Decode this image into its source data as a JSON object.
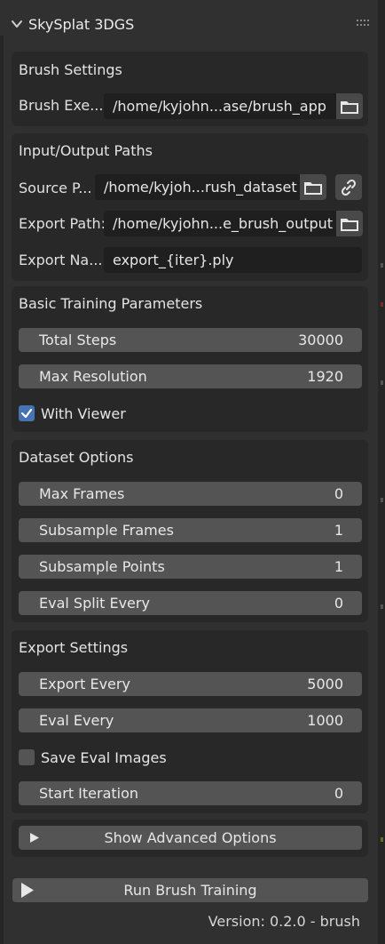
{
  "panel": {
    "title": "SkySplat 3DGS"
  },
  "brush_settings": {
    "title": "Brush Settings",
    "executable_label": "Brush Exe...",
    "executable_value": "/home/kyjohn...ase/brush_app"
  },
  "io_paths": {
    "title": "Input/Output Paths",
    "source_label": "Source P...",
    "source_value": "/home/kyjoh...rush_dataset",
    "export_path_label": "Export Path:",
    "export_path_value": "/home/kyjohn...e_brush_output",
    "export_name_label": "Export Na...",
    "export_name_value": "export_{iter}.ply"
  },
  "training": {
    "title": "Basic Training Parameters",
    "fields": [
      {
        "label": "Total Steps",
        "value": "30000"
      },
      {
        "label": "Max Resolution",
        "value": "1920"
      }
    ],
    "with_viewer_label": "With Viewer",
    "with_viewer_checked": true
  },
  "dataset": {
    "title": "Dataset Options",
    "fields": [
      {
        "label": "Max Frames",
        "value": "0"
      },
      {
        "label": "Subsample Frames",
        "value": "1"
      },
      {
        "label": "Subsample Points",
        "value": "1"
      },
      {
        "label": "Eval Split Every",
        "value": "0"
      }
    ]
  },
  "export": {
    "title": "Export Settings",
    "fields": [
      {
        "label": "Export Every",
        "value": "5000"
      },
      {
        "label": "Eval Every",
        "value": "1000"
      }
    ],
    "save_eval_label": "Save Eval Images",
    "save_eval_checked": false,
    "start_iteration": {
      "label": "Start Iteration",
      "value": "0"
    }
  },
  "advanced_button": "Show Advanced Options",
  "run_button": "Run Brush Training",
  "version": "Version: 0.2.0 - brush",
  "colors": {
    "panel_bg": "#303030",
    "box_bg": "#282828",
    "field_bg": "#545454",
    "checkbox_on": "#4772b3"
  }
}
